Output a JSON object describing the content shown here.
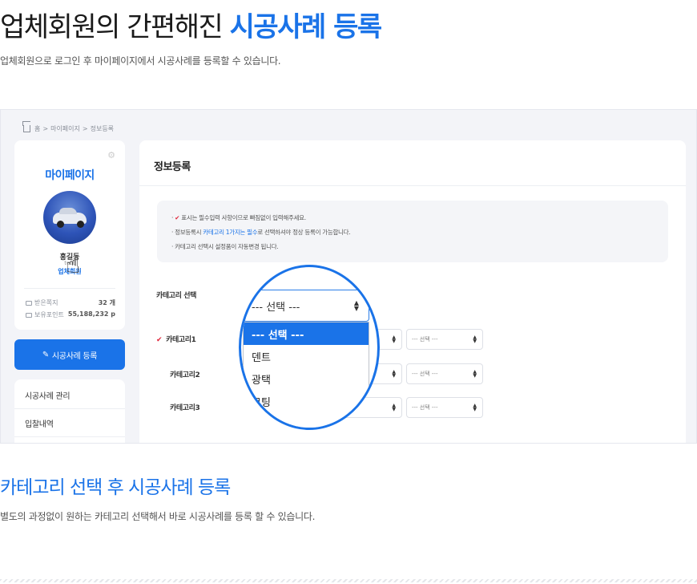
{
  "hero": {
    "title_main": "업체회원의 간편해진 ",
    "title_accent": "시공사례 등록",
    "subtitle": "업체회원으로 로그인 후 마이페이지에서 시공사례를 등록할 수 있습니다."
  },
  "breadcrumb": [
    "홈",
    "마이페이지",
    "정보등록"
  ],
  "sidebar": {
    "title": "마이페이지",
    "user_name": "홍길동",
    "user_id": "test",
    "user_type": "업체회원",
    "stats": [
      {
        "label": "받은쪽지",
        "value": "32 개",
        "icon": "mail-icon"
      },
      {
        "label": "보유포인트",
        "value": "55,188,232 p",
        "icon": "wallet-icon"
      }
    ],
    "register_button": "시공사례 등록",
    "menu": [
      "시공사례 관리",
      "입찰내역"
    ]
  },
  "main": {
    "title": "정보등록",
    "notice": {
      "line1_mark": "✔",
      "line1": " 표시는 필수입력 사항이므로 빠짐없이 입력해주세요.",
      "line2_pre": "정보등록시 ",
      "line2_highlight": "카테고리 1가지는 필수",
      "line2_post": "로 선택하셔야 정상 등록이 가능합니다.",
      "line3": "카테고리 선택시 설정품이 자동변경 됩니다."
    },
    "category_section_label": "카테고리 선택",
    "rows": [
      {
        "label": "카테고리1",
        "required": true
      },
      {
        "label": "카테고리2",
        "required": false
      },
      {
        "label": "카테고리3",
        "required": false
      }
    ],
    "select_placeholder": "--- 선택 ---"
  },
  "dropdown": {
    "current": "--- 선택 ---",
    "options": [
      "--- 선택 ---",
      "덴트",
      "광택",
      "코팅"
    ],
    "selected_index": 0
  },
  "section2": {
    "title": "카테고리 선택 후 시공사례 등록",
    "subtitle": "별도의 과정없이 원하는 카테고리 선택해서 바로 시공사례를 등록 할 수 있습니다."
  },
  "colors": {
    "accent": "#1a73e8",
    "required": "#e0263b",
    "panel_bg": "#f3f4f8"
  }
}
